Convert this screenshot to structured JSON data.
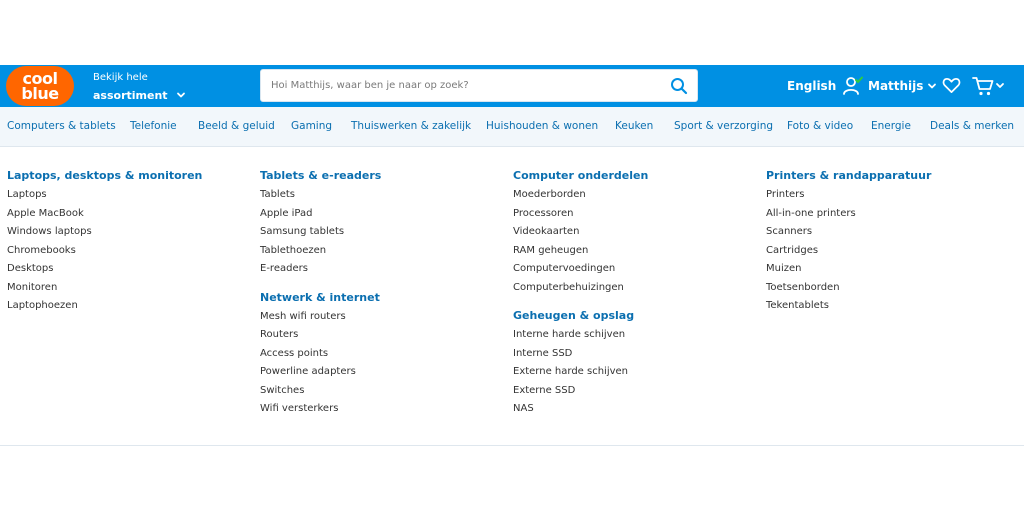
{
  "header": {
    "logo": {
      "line1": "cool",
      "line2": "blue"
    },
    "assortiment": {
      "line1": "Bekijk hele",
      "line2": "assortiment"
    },
    "search_placeholder": "Hoi Matthijs, waar ben je naar op zoek?",
    "language": "English",
    "user_name": "Matthijs",
    "colors": {
      "header_bg": "#0090e3",
      "logo_bg": "#ff6600",
      "check_green": "#2ecc40"
    },
    "icons": [
      "chevron-down-icon",
      "search-icon",
      "user-icon",
      "heart-icon",
      "cart-icon"
    ]
  },
  "nav": {
    "items": [
      "Computers & tablets",
      "Telefonie",
      "Beeld & geluid",
      "Gaming",
      "Thuiswerken & zakelijk",
      "Huishouden & wonen",
      "Keuken",
      "Sport & verzorging",
      "Foto & video",
      "Energie",
      "Deals & merken"
    ]
  },
  "menu": {
    "columns": [
      {
        "groups": [
          {
            "title": "Laptops, desktops & monitoren",
            "links": [
              "Laptops",
              "Apple MacBook",
              "Windows laptops",
              "Chromebooks",
              "Desktops",
              "Monitoren",
              "Laptophoezen"
            ]
          }
        ]
      },
      {
        "groups": [
          {
            "title": "Tablets & e-readers",
            "links": [
              "Tablets",
              "Apple iPad",
              "Samsung tablets",
              "Tablethoezen",
              "E-readers"
            ]
          },
          {
            "title": "Netwerk & internet",
            "links": [
              "Mesh wifi routers",
              "Routers",
              "Access points",
              "Powerline adapters",
              "Switches",
              "Wifi versterkers"
            ]
          }
        ]
      },
      {
        "groups": [
          {
            "title": "Computer onderdelen",
            "links": [
              "Moederborden",
              "Processoren",
              "Videokaarten",
              "RAM geheugen",
              "Computervoedingen",
              "Computerbehuizingen"
            ]
          },
          {
            "title": "Geheugen & opslag",
            "links": [
              "Interne harde schijven",
              "Interne SSD",
              "Externe harde schijven",
              "Externe SSD",
              "NAS"
            ]
          }
        ]
      },
      {
        "groups": [
          {
            "title": "Printers & randapparatuur",
            "links": [
              "Printers",
              "All-in-one printers",
              "Scanners",
              "Cartridges",
              "Muizen",
              "Toetsenborden",
              "Tekentablets"
            ]
          }
        ]
      }
    ]
  }
}
